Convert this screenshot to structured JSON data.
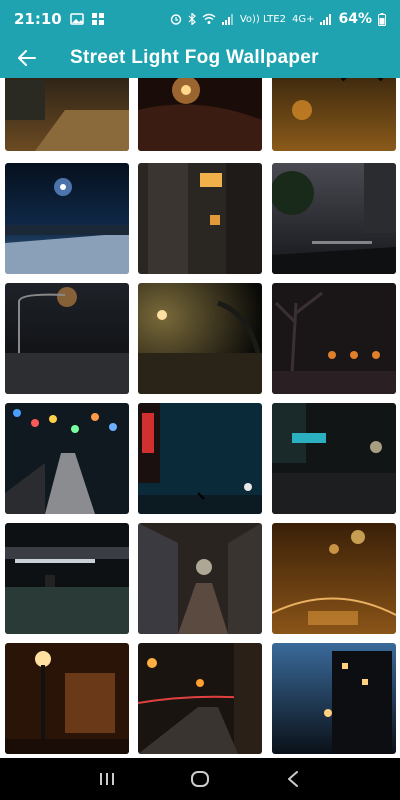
{
  "status": {
    "time": "21:10",
    "network": "Vo)) LTE2",
    "signal_label": "4G+",
    "battery": "64%"
  },
  "app_bar": {
    "title": "Street Light Fog Wallpaper"
  },
  "icons": {
    "back": "arrow-back-icon",
    "recents": "recents-icon",
    "home": "home-icon",
    "nav_back": "nav-back-icon"
  },
  "colors": {
    "primary": "#1fa3b1",
    "nav": "#000000"
  },
  "wallpapers": [
    "street-scene-1",
    "street-scene-2",
    "street-scene-3",
    "street-scene-4",
    "street-scene-5",
    "street-scene-6",
    "street-scene-7",
    "street-scene-8",
    "street-scene-9",
    "street-scene-10",
    "street-scene-11",
    "street-scene-12",
    "street-scene-13",
    "street-scene-14",
    "street-scene-15",
    "street-scene-16",
    "street-scene-17",
    "street-scene-18"
  ]
}
